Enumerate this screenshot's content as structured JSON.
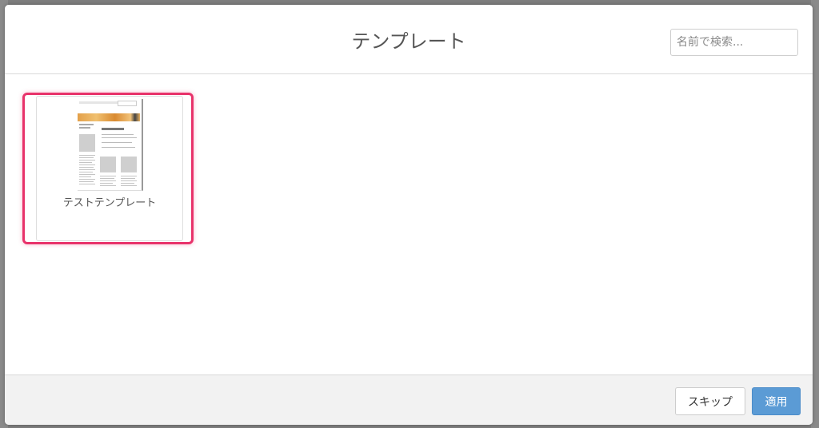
{
  "modal": {
    "title": "テンプレート"
  },
  "search": {
    "placeholder": "名前で検索..."
  },
  "templates": [
    {
      "label": "テストテンプレート"
    }
  ],
  "footer": {
    "skip_label": "スキップ",
    "apply_label": "適用"
  },
  "colors": {
    "highlight": "#e8336b",
    "apply_button": "#5b9bd5"
  }
}
